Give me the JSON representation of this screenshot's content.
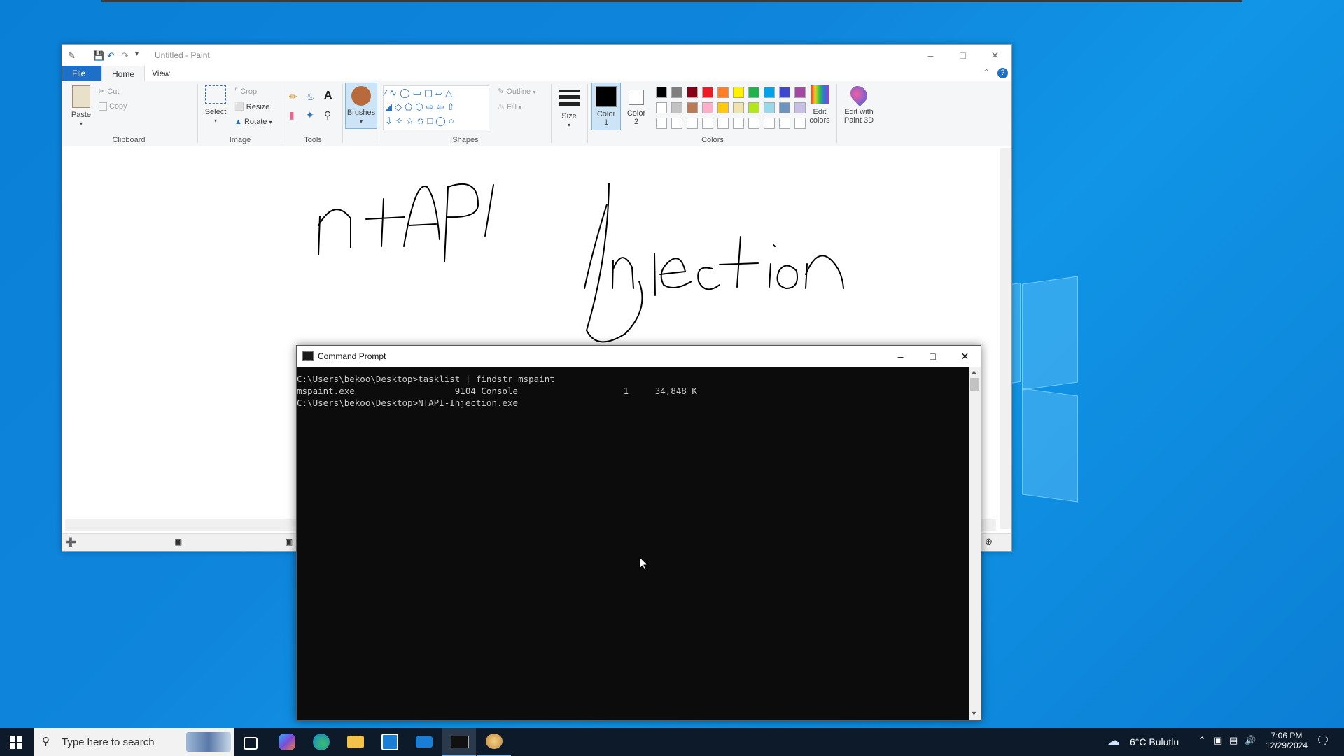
{
  "paint": {
    "title": "Untitled - Paint",
    "tabs": {
      "file": "File",
      "home": "Home",
      "view": "View"
    },
    "clipboard": {
      "paste": "Paste",
      "cut": "Cut",
      "copy": "Copy",
      "group": "Clipboard"
    },
    "image": {
      "select": "Select",
      "crop": "Crop",
      "resize": "Resize",
      "rotate": "Rotate",
      "group": "Image"
    },
    "tools": {
      "group": "Tools"
    },
    "brushes": "Brushes",
    "shapes": {
      "outline": "Outline",
      "fill": "Fill",
      "group": "Shapes"
    },
    "size": "Size",
    "color1": {
      "line1": "Color",
      "line2": "1"
    },
    "color2": {
      "line1": "Color",
      "line2": "2"
    },
    "colors_group": "Colors",
    "edit_colors": {
      "line1": "Edit",
      "line2": "colors"
    },
    "paint3d": {
      "line1": "Edit with",
      "line2": "Paint 3D"
    },
    "canvas_text": {
      "left": "ntAPI",
      "right": "Injection"
    },
    "palette_row1": [
      "#000000",
      "#7f7f7f",
      "#880015",
      "#ed1c24",
      "#ff7f27",
      "#fff200",
      "#22b14c",
      "#00a2e8",
      "#3f48cc",
      "#a349a4"
    ],
    "palette_row2": [
      "#ffffff",
      "#c3c3c3",
      "#b97a57",
      "#ffaec9",
      "#ffc90e",
      "#efe4b0",
      "#b5e61d",
      "#99d9ea",
      "#7092be",
      "#c8bfe7"
    ]
  },
  "cmd": {
    "title": "Command Prompt",
    "lines": [
      "C:\\Users\\bekoo\\Desktop>tasklist | findstr mspaint",
      "mspaint.exe                   9104 Console                    1     34,848 K",
      "",
      "C:\\Users\\bekoo\\Desktop>NTAPI-Injection.exe"
    ]
  },
  "taskbar": {
    "search_placeholder": "Type here to search",
    "weather": "6°C  Bulutlu",
    "time": "7:06 PM",
    "date": "12/29/2024"
  }
}
